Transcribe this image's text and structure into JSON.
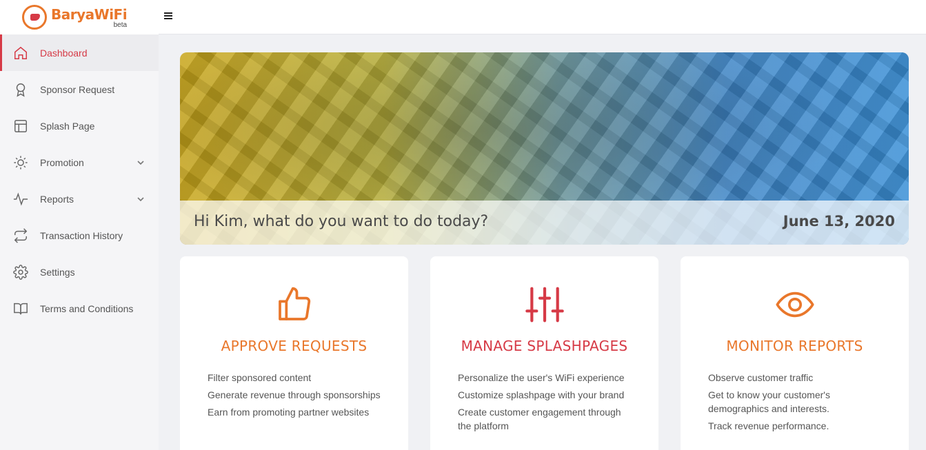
{
  "app": {
    "logo_name": "BaryaWiFi",
    "logo_badge": "beta",
    "accent_color": "#e9772b",
    "brand_red": "#d63a46"
  },
  "sidebar": {
    "items": [
      {
        "label": "Dashboard",
        "icon": "home-icon",
        "active": true
      },
      {
        "label": "Sponsor Request",
        "icon": "award-icon"
      },
      {
        "label": "Splash Page",
        "icon": "layout-icon"
      },
      {
        "label": "Promotion",
        "icon": "sun-icon",
        "expandable": true
      },
      {
        "label": "Reports",
        "icon": "activity-icon",
        "expandable": true
      },
      {
        "label": "Transaction History",
        "icon": "repeat-icon"
      },
      {
        "label": "Settings",
        "icon": "gear-icon"
      },
      {
        "label": "Terms and Conditions",
        "icon": "book-icon"
      }
    ]
  },
  "header": {
    "menu_icon": "hamburger-icon"
  },
  "banner": {
    "greeting": "Hi Kim, what do you want to do today?",
    "date": "June 13, 2020"
  },
  "cards": [
    {
      "icon": "thumbs-up-icon",
      "title": "APPROVE REQUESTS",
      "color": "#e9772b",
      "items": [
        "Filter sponsored content",
        "Generate revenue through sponsorships",
        "Earn from promoting partner websites"
      ]
    },
    {
      "icon": "sliders-icon",
      "title": "MANAGE SPLASHPAGES",
      "color": "#d63a46",
      "items": [
        "Personalize the user's WiFi experience",
        "Customize splashpage with your brand",
        "Create customer engagement through the platform"
      ]
    },
    {
      "icon": "eye-icon",
      "title": "MONITOR REPORTS",
      "color": "#e9772b",
      "items": [
        "Observe customer traffic",
        "Get to know your customer's demographics and interests.",
        "Track revenue performance."
      ]
    }
  ]
}
